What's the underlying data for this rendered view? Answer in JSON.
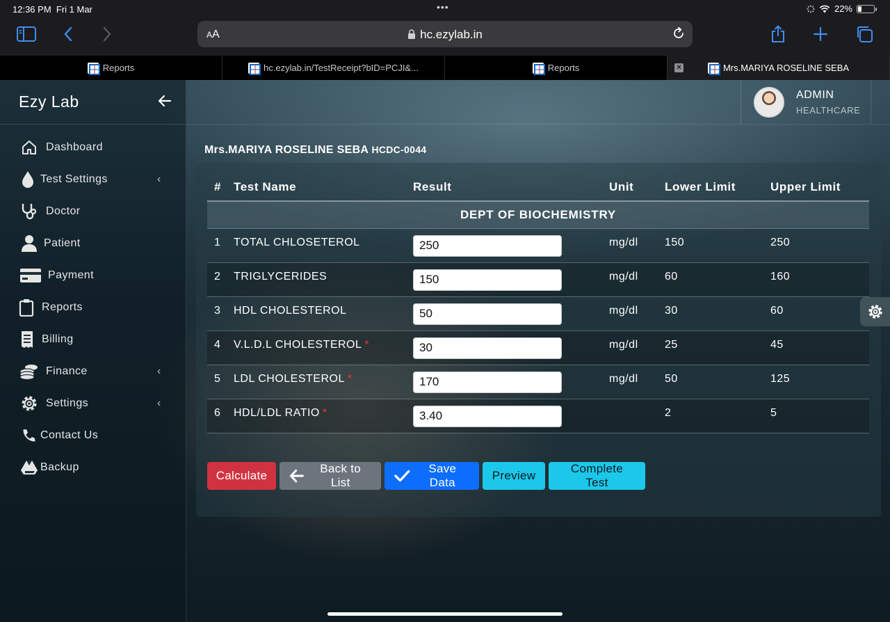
{
  "status_bar": {
    "time": "12:36 PM",
    "date": "Fri 1 Mar",
    "battery": "22%",
    "battery_level": 0.22
  },
  "browser": {
    "aa_label": "AA",
    "host": "hc.ezylab.in",
    "tabs": [
      {
        "title": "Reports"
      },
      {
        "title": "hc.ezylab.in/TestReceipt?bID=PCJI&..."
      },
      {
        "title": "Reports"
      },
      {
        "title": "Mrs.MARIYA ROSELINE SEBA"
      }
    ]
  },
  "app": {
    "brand": "Ezy Lab",
    "nav": [
      {
        "label": "Dashboard",
        "icon": "home-icon"
      },
      {
        "label": "Test Settings",
        "icon": "drop-icon",
        "submenu": true
      },
      {
        "label": "Doctor",
        "icon": "stethoscope-icon"
      },
      {
        "label": "Patient",
        "icon": "user-icon"
      },
      {
        "label": "Payment",
        "icon": "credit-card-icon"
      },
      {
        "label": "Reports",
        "icon": "clipboard-icon"
      },
      {
        "label": "Billing",
        "icon": "receipt-icon"
      },
      {
        "label": "Finance",
        "icon": "coins-icon",
        "submenu": true
      },
      {
        "label": "Settings",
        "icon": "gear-icon",
        "submenu": true
      },
      {
        "label": "Contact Us",
        "icon": "phone-icon"
      },
      {
        "label": "Backup",
        "icon": "drive-icon"
      }
    ],
    "profile": {
      "role": "ADMIN",
      "org": "HEALTHCARE"
    }
  },
  "main": {
    "patient_name": "Mrs.MARIYA ROSELINE SEBA",
    "patient_code": "HCDC-0044",
    "table": {
      "headers": [
        "#",
        "Test Name",
        "Result",
        "Unit",
        "Lower Limit",
        "Upper Limit"
      ],
      "department": "DEPT OF BIOCHEMISTRY",
      "rows": [
        {
          "no": "1",
          "name": "TOTAL CHLOSETEROL",
          "required": false,
          "result": "250",
          "unit": "mg/dl",
          "lower": "150",
          "upper": "250"
        },
        {
          "no": "2",
          "name": "TRIGLYCERIDES",
          "required": false,
          "result": "150",
          "unit": "mg/dl",
          "lower": "60",
          "upper": "160"
        },
        {
          "no": "3",
          "name": "HDL CHOLESTEROL",
          "required": false,
          "result": "50",
          "unit": "mg/dl",
          "lower": "30",
          "upper": "60"
        },
        {
          "no": "4",
          "name": "V.L.D.L CHOLESTEROL",
          "required": true,
          "result": "30",
          "unit": "mg/dl",
          "lower": "25",
          "upper": "45"
        },
        {
          "no": "5",
          "name": "LDL CHOLESTEROL",
          "required": true,
          "result": "170",
          "unit": "mg/dl",
          "lower": "50",
          "upper": "125"
        },
        {
          "no": "6",
          "name": "HDL/LDL RATIO",
          "required": true,
          "result": "3.40",
          "unit": "",
          "lower": "2",
          "upper": "5"
        }
      ],
      "required_marker": "*"
    },
    "buttons": {
      "calculate": "Calculate",
      "back": "Back to List",
      "save": "Save Data",
      "preview": "Preview",
      "complete": "Complete Test"
    }
  },
  "colors": {
    "calculate": "#d0333f",
    "back": "#6c757d",
    "save": "#0d6efd",
    "info": "#1cc8ea",
    "required": "#e53935"
  }
}
